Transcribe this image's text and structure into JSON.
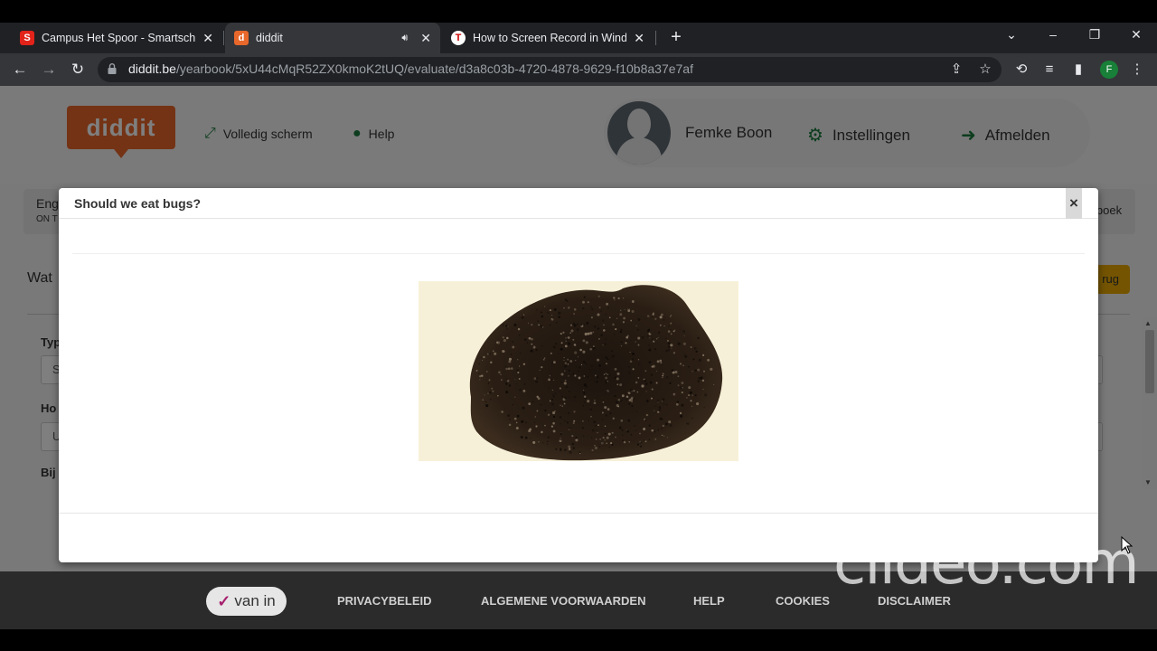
{
  "browser": {
    "tabs": [
      {
        "title": "Campus Het Spoor - Smartschool",
        "favicon": "S",
        "favicon_color": "#e2231a",
        "active": false
      },
      {
        "title": "diddit",
        "favicon": "d",
        "favicon_color": "#e8672b",
        "active": true,
        "audio": true
      },
      {
        "title": "How to Screen Record in Windows",
        "favicon": "T",
        "favicon_color": "#ffffff",
        "active": false
      }
    ],
    "url_domain": "diddit.be",
    "url_path": "/yearbook/5xU44cMqR52ZX0kmoK2tUQ/evaluate/d3a8c03b-4720-4878-9629-f10b8a37e7af",
    "profile_initial": "F"
  },
  "header": {
    "logo": "diddit",
    "fullscreen_label": "Volledig scherm",
    "help_label": "Help",
    "user_name": "Femke Boon",
    "settings_label": "Instellingen",
    "logout_label": "Afmelden"
  },
  "subbar": {
    "title": "Eng",
    "subtitle": "ON T",
    "right": "lboek"
  },
  "content": {
    "title": "Wat",
    "back": "rug",
    "labels": [
      "Typ",
      "Ho",
      "Bij"
    ],
    "inputs": [
      "S",
      "U"
    ]
  },
  "modal": {
    "title": "Should we eat bugs?",
    "close": "×"
  },
  "footer": {
    "brand": "van in",
    "links": [
      "PRIVACYBELEID",
      "ALGEMENE VOORWAARDEN",
      "HELP",
      "COOKIES",
      "DISCLAIMER"
    ]
  },
  "watermark": "clideo.com",
  "colors": {
    "accent_green": "#1a7a3c",
    "logo_orange": "#e8672b",
    "back_button": "#e8a900",
    "brand_magenta": "#a7206f"
  }
}
